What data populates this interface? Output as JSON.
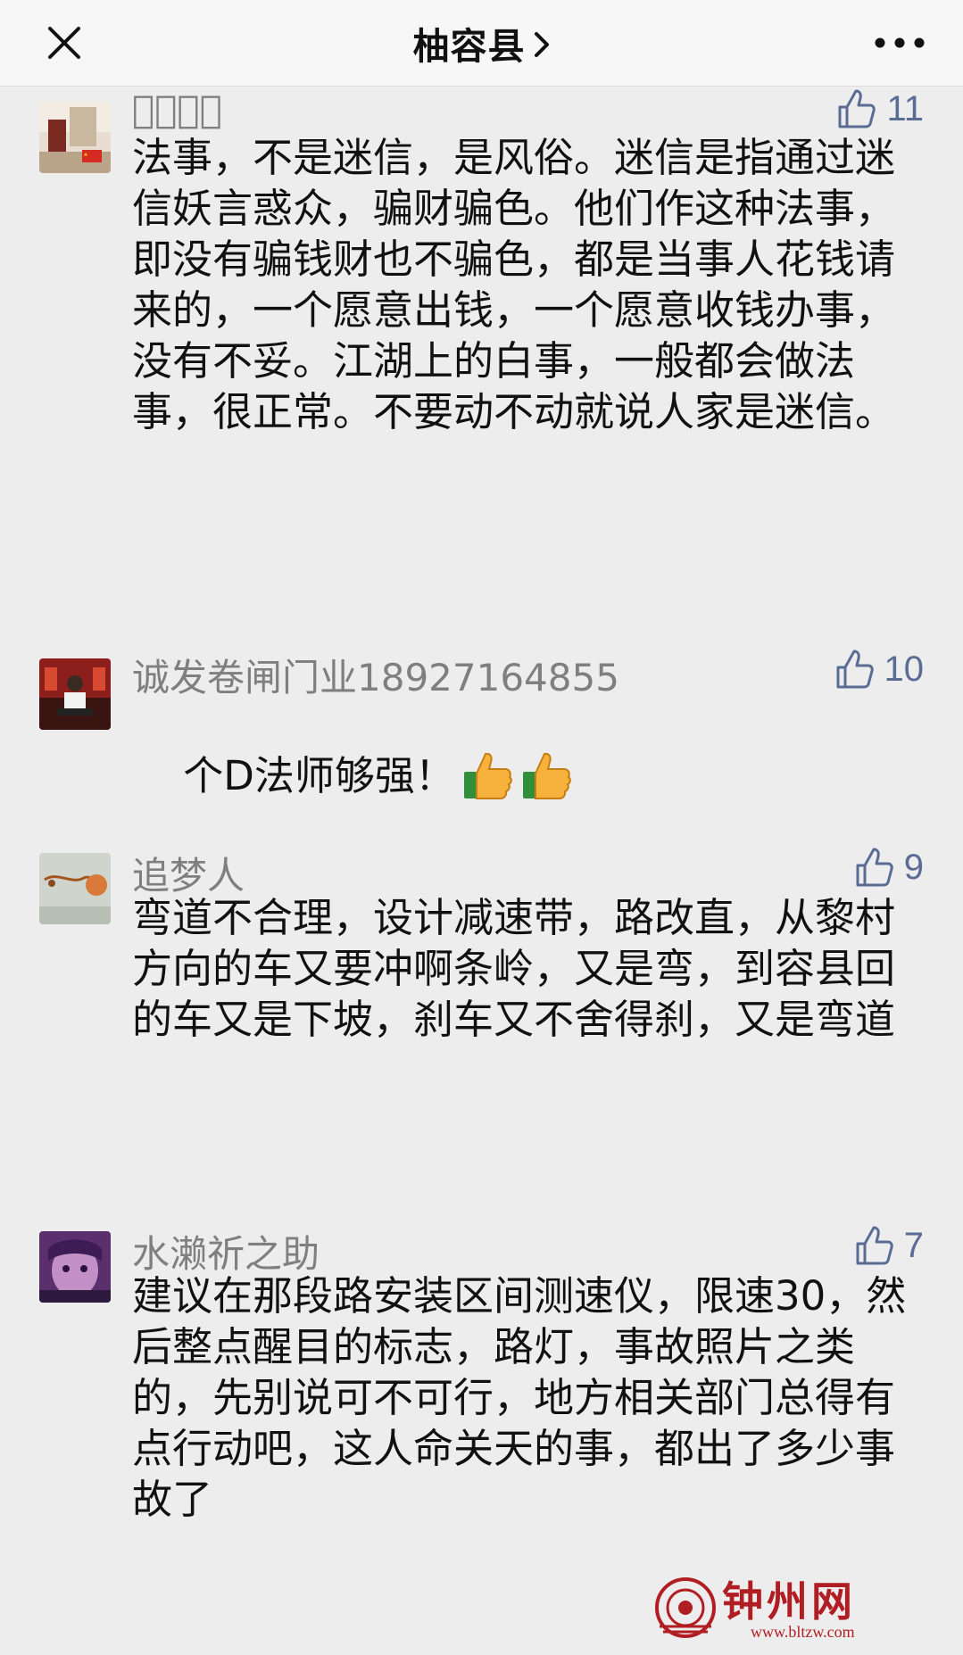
{
  "header": {
    "title": "柚容县",
    "close_icon": "close-icon",
    "more_icon": "more-icon"
  },
  "comments": [
    {
      "nickname": "时⃠间⃠",
      "likes": "11",
      "text": "法事，不是迷信，是风俗。迷信是指通过迷信妖言惑众，骗财骗色。他们作这种法事，即没有骗钱财也不骗色，都是当事人花钱请来的，一个愿意出钱，一个愿意收钱办事，没有不妥。江湖上的白事，一般都会做法事，很正常。不要动不动就说人家是迷信。"
    },
    {
      "nickname": "诚发卷闸门业18927164855",
      "likes": "10",
      "text": "个D法师够强！"
    },
    {
      "nickname": "追梦人",
      "likes": "9",
      "text": "弯道不合理，设计减速带，路改直，从黎村方向的车又要冲啊条岭，又是弯，到容县回的车又是下坡，刹车又不舍得刹，又是弯道"
    },
    {
      "nickname": "水濑祈之助",
      "likes": "7",
      "text": "建议在那段路安装区间测速仪，限速30，然后整点醒目的标志，路灯，事故照片之类的，先别说可不可行，地方相关部门总得有点行动吧，这人命关天的事，都出了多少事故了"
    }
  ],
  "watermark": {
    "name": "钟州网",
    "url": "www.bltzw.com"
  },
  "colors": {
    "background": "#ededed",
    "nickname": "#7f7f7f",
    "like": "#5a6c94",
    "text": "#111111",
    "watermark": "#b01e24"
  }
}
